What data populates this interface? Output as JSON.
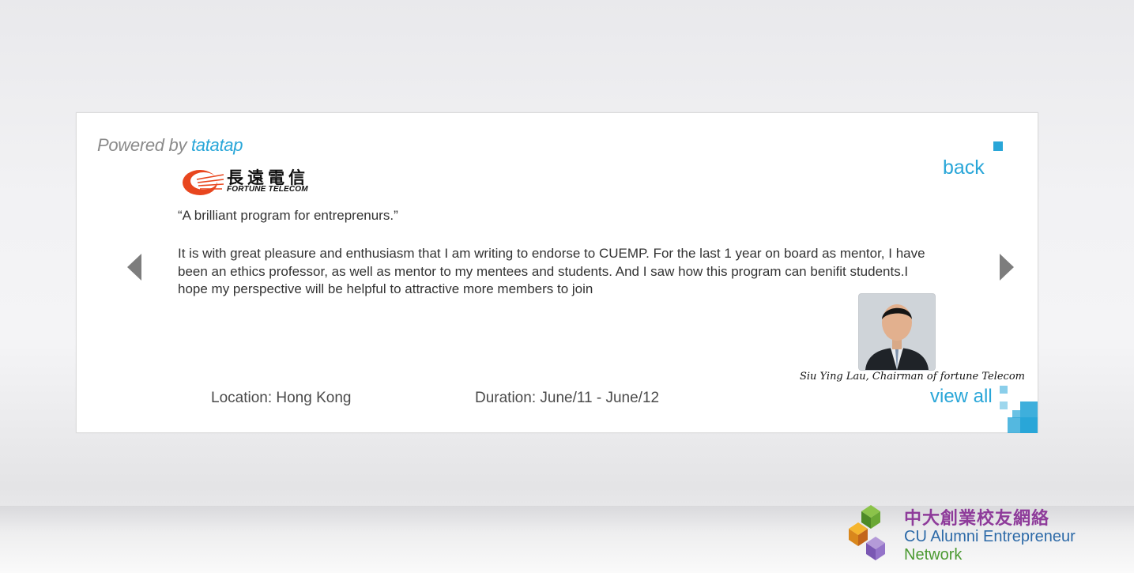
{
  "header": {
    "powered_prefix": "Powered by",
    "powered_brand": "tatatap",
    "back_label": "back"
  },
  "company": {
    "logo_cn": "長遠電信",
    "logo_en": "FORTUNE TELECOM"
  },
  "testimonial": {
    "quote": "“A brilliant program for entreprenurs.”",
    "body": "It is with great pleasure and enthusiasm that I am writing to endorse  to CUEMP. For the last 1 year on board as mentor, I have been an ethics professor, as well as mentor to my mentees and students. And I saw how this program can benifit students.I hope my perspective will be helpful to attractive more members to join",
    "author": "Siu Ying Lau, Chairman of fortune Telecom"
  },
  "details": {
    "location": "Location: Hong Kong",
    "duration": "Duration: June/11 - June/12"
  },
  "actions": {
    "view_all_label": "view all"
  },
  "footer": {
    "org_cn": "中大創業校友網絡",
    "org_en_line1": "CU Alumni Entrepreneur",
    "org_en_line2": "Network"
  },
  "colors": {
    "accent": "#29a6d8",
    "logo_orange": "#e8461e",
    "org_purple": "#8e3b9a",
    "org_blue": "#2d6aa8",
    "org_green": "#4b9a32"
  },
  "icons": {
    "prev": "chevron-left-icon",
    "next": "chevron-right-icon"
  }
}
